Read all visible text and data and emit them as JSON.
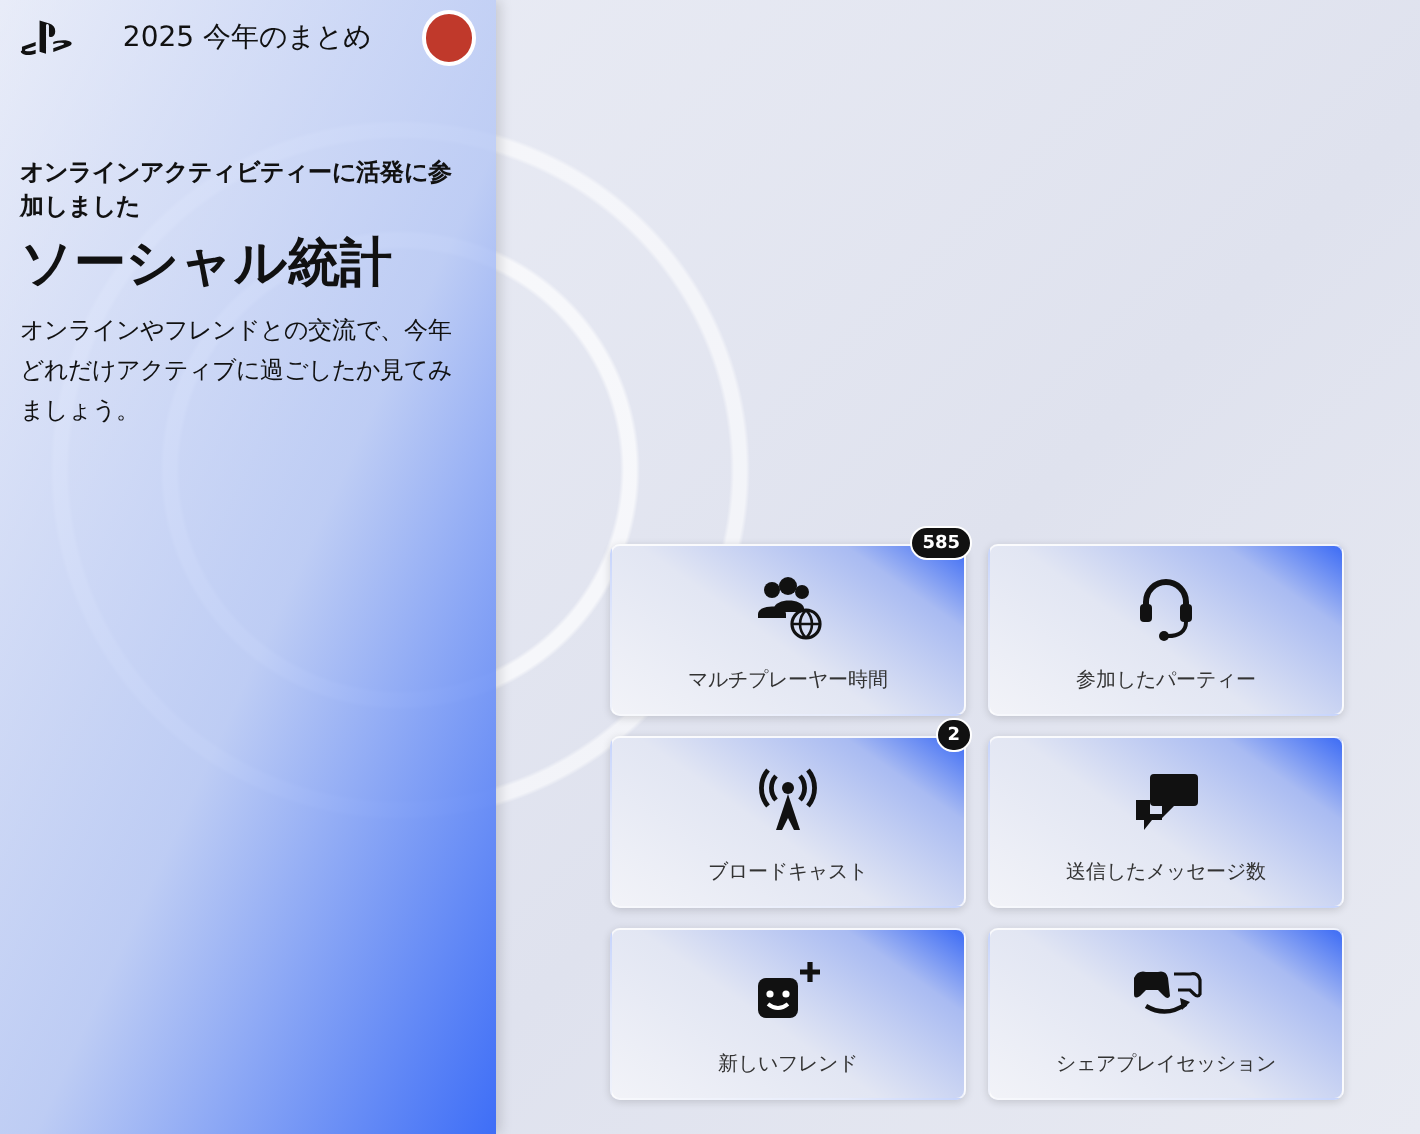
{
  "header": {
    "title": "2025 今年のまとめ"
  },
  "intro": {
    "eyebrow": "オンラインアクティビティーに活発に参加しました",
    "heading": "ソーシャル統計",
    "description": "オンラインやフレンドとの交流で、今年どれだけアクティブに過ごしたか見てみましょう。"
  },
  "cards": [
    {
      "kind": "multiplayer",
      "label": "マルチプレーヤー時間",
      "badge": "585"
    },
    {
      "kind": "party",
      "label": "参加したパーティー"
    },
    {
      "kind": "broadcast",
      "label": "ブロードキャスト",
      "badge": "2"
    },
    {
      "kind": "messages",
      "label": "送信したメッセージ数"
    },
    {
      "kind": "friend",
      "label": "新しいフレンド"
    },
    {
      "kind": "shareplay",
      "label": "シェアプレイセッション"
    }
  ]
}
